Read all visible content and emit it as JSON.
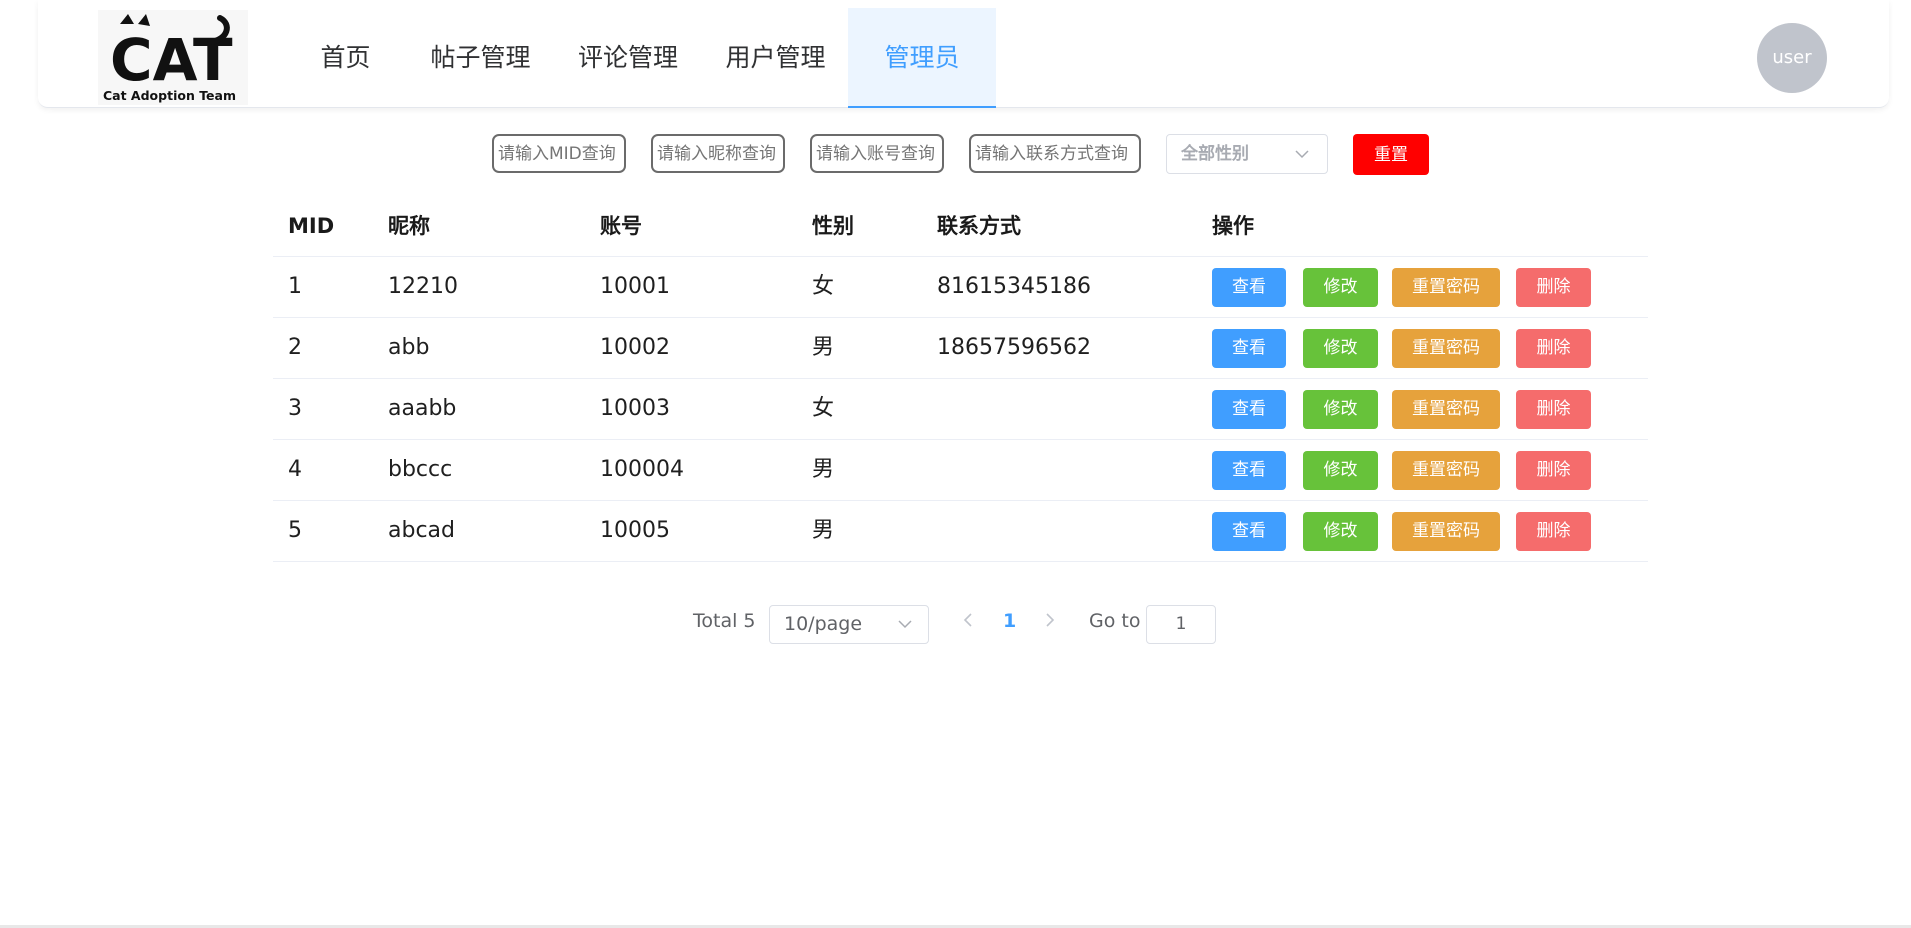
{
  "header": {
    "logo_text": "CAT",
    "logo_subtitle": "Cat Adoption Team",
    "nav": [
      {
        "label": "首页"
      },
      {
        "label": "帖子管理"
      },
      {
        "label": "评论管理"
      },
      {
        "label": "用户管理"
      },
      {
        "label": "管理员",
        "active": true
      }
    ],
    "avatar_label": "user"
  },
  "filters": {
    "mid_placeholder": "请输入MID查询",
    "nickname_placeholder": "请输入昵称查询",
    "account_placeholder": "请输入账号查询",
    "contact_placeholder": "请输入联系方式查询",
    "gender_select": "全部性别",
    "reset_label": "重置"
  },
  "table": {
    "columns": [
      "MID",
      "昵称",
      "账号",
      "性别",
      "联系方式",
      "操作"
    ],
    "actions": {
      "view": "查看",
      "edit": "修改",
      "reset_password": "重置密码",
      "delete": "删除"
    },
    "rows": [
      {
        "mid": "1",
        "nickname": "12210",
        "account": "10001",
        "gender": "女",
        "contact": "81615345186"
      },
      {
        "mid": "2",
        "nickname": "abb",
        "account": "10002",
        "gender": "男",
        "contact": "18657596562"
      },
      {
        "mid": "3",
        "nickname": "aaabb",
        "account": "10003",
        "gender": "女",
        "contact": ""
      },
      {
        "mid": "4",
        "nickname": "bbccc",
        "account": "100004",
        "gender": "男",
        "contact": ""
      },
      {
        "mid": "5",
        "nickname": "abcad",
        "account": "10005",
        "gender": "男",
        "contact": ""
      }
    ]
  },
  "pagination": {
    "total_label": "Total 5",
    "page_size": "10/page",
    "current_page": "1",
    "goto_label": "Go to",
    "goto_value": "1"
  },
  "colors": {
    "primary": "#409eff",
    "success": "#67c23a",
    "warning": "#e6a23c",
    "danger": "#f56c6c",
    "reset": "#ff0000"
  },
  "icons": [
    "chevron-down-icon",
    "chevron-left-icon",
    "chevron-right-icon"
  ]
}
